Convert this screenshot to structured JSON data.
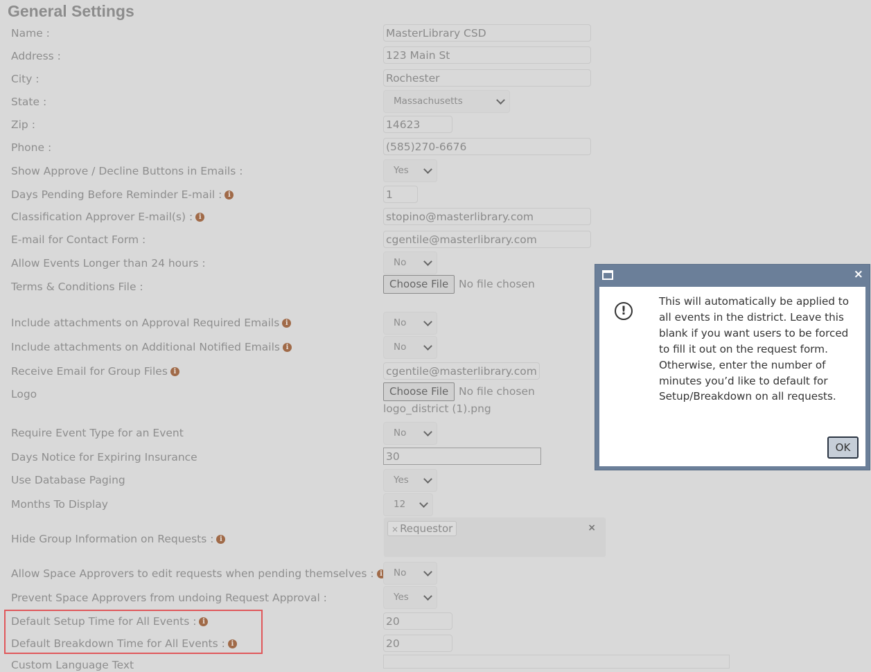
{
  "title": "General Settings",
  "fields": {
    "name": {
      "label": "Name :",
      "value": "MasterLibrary CSD"
    },
    "address": {
      "label": "Address :",
      "value": "123 Main St"
    },
    "city": {
      "label": "City :",
      "value": "Rochester"
    },
    "state": {
      "label": "State :",
      "value": "Massachusetts"
    },
    "zip": {
      "label": "Zip :",
      "value": "14623"
    },
    "phone": {
      "label": "Phone :",
      "value": "(585)270-6676"
    },
    "approve_buttons": {
      "label": "Show Approve / Decline Buttons in Emails :",
      "value": "Yes"
    },
    "days_pending": {
      "label": "Days Pending Before Reminder E-mail :",
      "value": "1"
    },
    "class_approver": {
      "label": "Classification Approver E-mail(s) :",
      "value": "stopino@masterlibrary.com"
    },
    "contact_email": {
      "label": "E-mail for Contact Form :",
      "value": "cgentile@masterlibrary.com"
    },
    "longer_24": {
      "label": "Allow Events Longer than 24 hours :",
      "value": "No"
    },
    "terms_file": {
      "label": "Terms & Conditions File :",
      "button": "Choose File",
      "status": "No file chosen"
    },
    "attach_approval": {
      "label": "Include attachments on Approval Required Emails",
      "value": "No"
    },
    "attach_notified": {
      "label": "Include attachments on Additional Notified Emails",
      "value": "No"
    },
    "group_files_email": {
      "label": "Receive Email for Group Files",
      "value": "cgentile@masterlibrary.com"
    },
    "logo": {
      "label": "Logo",
      "button": "Choose File",
      "status": "No file chosen",
      "current_file": "logo_district (1).png"
    },
    "event_type": {
      "label": "Require Event Type for an Event",
      "value": "No"
    },
    "days_insurance": {
      "label": "Days Notice for Expiring Insurance",
      "value": "30"
    },
    "db_paging": {
      "label": "Use Database Paging",
      "value": "Yes"
    },
    "months_display": {
      "label": "Months To Display",
      "value": "12"
    },
    "hide_group": {
      "label": "Hide Group Information on Requests :",
      "tag": "Requestor",
      "tag_remove": "×",
      "clear": "×"
    },
    "approver_edit": {
      "label": "Allow Space Approvers to edit requests when pending themselves :",
      "value": "No"
    },
    "prevent_undo": {
      "label": "Prevent Space Approvers from undoing Request Approval :",
      "value": "Yes"
    },
    "setup_time": {
      "label": "Default Setup Time for All Events :",
      "value": "20"
    },
    "breakdown_time": {
      "label": "Default Breakdown Time for All Events :",
      "value": "20"
    },
    "custom_text": {
      "label": "Custom Language Text"
    }
  },
  "info_glyph": "i",
  "dialog": {
    "close": "×",
    "alert_glyph": "!",
    "message": "This will automatically be applied to all events in the district. Leave this blank if you want users to be forced to fill it out on the request form. Otherwise, enter the number of minutes you’d like to default for Setup/Breakdown on all requests.",
    "ok_label": "OK"
  }
}
